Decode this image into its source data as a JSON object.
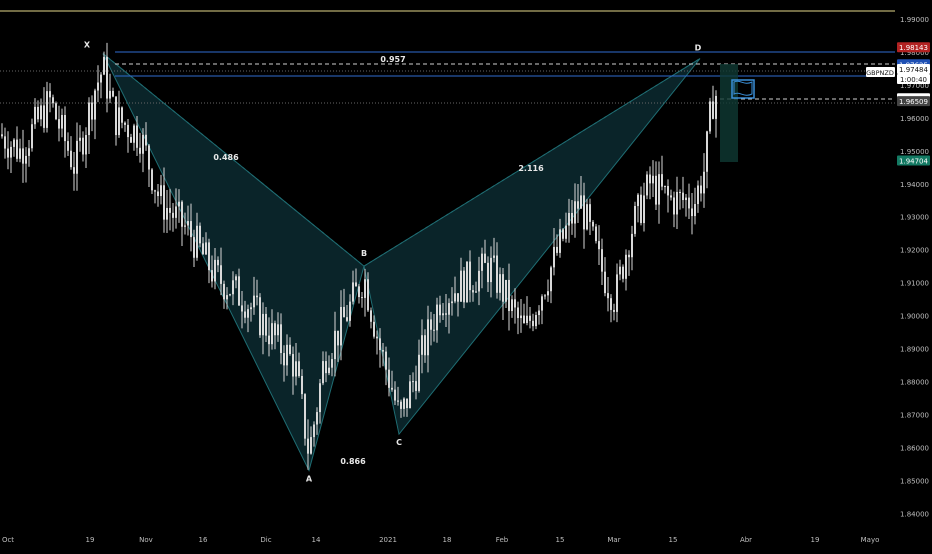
{
  "chart_data": {
    "type": "candlestick",
    "symbol_tag": "GBPNZD",
    "x_tick_labels": [
      "Oct",
      "19",
      "Nov",
      "16",
      "Dic",
      "14",
      "2021",
      "18",
      "Feb",
      "15",
      "Mar",
      "15",
      "Abr",
      "19",
      "Mayo"
    ],
    "y_tick_labels": [
      "1.99000",
      "1.98000",
      "1.97000",
      "1.96000",
      "1.95000",
      "1.94000",
      "1.93000",
      "1.92000",
      "1.91000",
      "1.90000",
      "1.89000",
      "1.88000",
      "1.87000",
      "1.86000",
      "1.85000",
      "1.84000"
    ],
    "y_ticks": [
      1.99,
      1.98,
      1.97,
      1.96,
      1.95,
      1.94,
      1.93,
      1.92,
      1.91,
      1.9,
      1.89,
      1.88,
      1.87,
      1.86,
      1.85,
      1.84
    ],
    "ylim": [
      1.8375,
      1.9945
    ],
    "price_tags": [
      {
        "label": "1.98143",
        "value": 1.98143,
        "color": "#b22222"
      },
      {
        "label": "1.97625",
        "value": 1.97625,
        "color": "#1e50b4"
      },
      {
        "label": "1.97484",
        "value": 1.97484,
        "color": "#ffffff"
      },
      {
        "label": "1.96594",
        "value": 1.96594,
        "color": "#ffffff"
      },
      {
        "label": "1.96509",
        "value": 1.96509,
        "color": "#444444"
      },
      {
        "label": "1.94704",
        "value": 1.94704,
        "color": "#137a63"
      }
    ],
    "current_price_label": "1.97484",
    "countdown_label": "1:00:40",
    "pattern": {
      "points": [
        {
          "label": "X",
          "price": 1.9795
        },
        {
          "label": "A",
          "price": 1.853
        },
        {
          "label": "B",
          "price": 1.915
        },
        {
          "label": "C",
          "price": 1.864
        },
        {
          "label": "D",
          "price": 1.978
        }
      ],
      "ratios": [
        "0.486",
        "0.866",
        "2.116",
        "0.957"
      ]
    },
    "colors": {
      "background": "#000000",
      "candle": "#d9d9d9",
      "pattern_fill": "#0c2a30",
      "pattern_line": "#1f6d73",
      "blue_line": "#2f6bd0",
      "top_line": "#e3d98a"
    }
  }
}
